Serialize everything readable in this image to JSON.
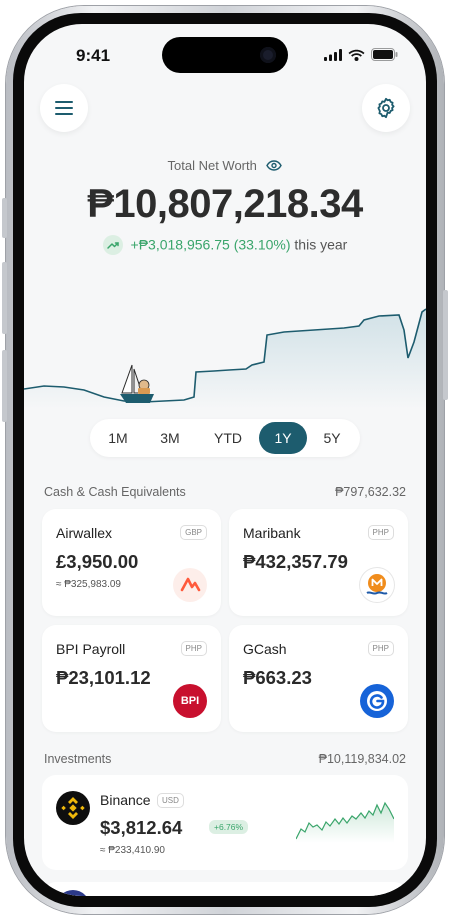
{
  "status": {
    "time": "9:41"
  },
  "header": {
    "net_worth_label": "Total Net Worth",
    "net_worth_value": "₱10,807,218.34",
    "change_text": "+₱3,018,956.75 (33.10%)",
    "change_period": "this year"
  },
  "periods": [
    {
      "label": "1M",
      "active": false
    },
    {
      "label": "3M",
      "active": false
    },
    {
      "label": "YTD",
      "active": false
    },
    {
      "label": "1Y",
      "active": true
    },
    {
      "label": "5Y",
      "active": false
    }
  ],
  "cash": {
    "title": "Cash & Cash Equivalents",
    "total": "₱797,632.32",
    "accounts": [
      {
        "name": "Airwallex",
        "currency": "GBP",
        "amount": "£3,950.00",
        "sub": "≈ ₱325,983.09",
        "logo": "airwallex-logo"
      },
      {
        "name": "Maribank",
        "currency": "PHP",
        "amount": "₱432,357.79",
        "sub": "",
        "logo": "maribank-logo"
      },
      {
        "name": "BPI Payroll",
        "currency": "PHP",
        "amount": "₱23,101.12",
        "sub": "",
        "logo": "bpi-logo",
        "logo_text": "BPI"
      },
      {
        "name": "GCash",
        "currency": "PHP",
        "amount": "₱663.23",
        "sub": "",
        "logo": "gcash-logo"
      }
    ]
  },
  "investments": {
    "title": "Investments",
    "total": "₱10,119,834.02",
    "items": [
      {
        "name": "Binance",
        "currency": "USD",
        "amount": "$3,812.64",
        "change": "+6.76%",
        "sub": "≈ ₱233,410.90",
        "logo": "binance-logo"
      }
    ]
  },
  "colors": {
    "accent": "#1d5c6e",
    "positive": "#3aa56b",
    "background": "#f6f7f8"
  }
}
